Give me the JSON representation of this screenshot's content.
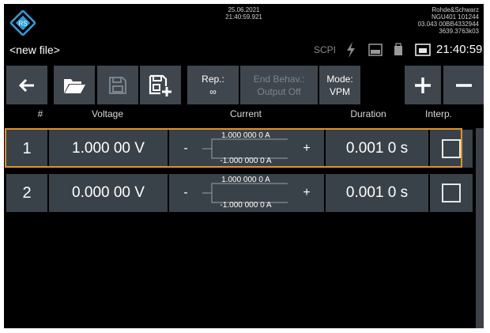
{
  "status": {
    "date": "25.06.2021",
    "time_precise": "21:40:59.921",
    "brand": "Rohde&Schwarz",
    "model": "NGU401 101244",
    "firmware": "03.043 00BB4332944",
    "version": "3639.3763k03",
    "scpi_label": "SCPI",
    "clock": "21:40:59"
  },
  "file": {
    "name": "<new file>"
  },
  "toolbar": {
    "repetition": {
      "label": "Rep.:",
      "value": "∞"
    },
    "end_behavior": {
      "label": "End Behav.:",
      "value": "Output Off"
    },
    "mode": {
      "label": "Mode:",
      "value": "VPM"
    }
  },
  "table": {
    "headers": {
      "index": "#",
      "voltage": "Voltage",
      "current": "Current",
      "duration": "Duration",
      "interp": "Interp."
    },
    "rows": [
      {
        "index": "1",
        "voltage": "1.000 00 V",
        "current_upper": "1.000 000 0 A",
        "current_lower": "-1.000 000 0 A",
        "minus": "-",
        "plus": "+",
        "duration": "0.001 0 s",
        "interp": false
      },
      {
        "index": "2",
        "voltage": "0.000 00 V",
        "current_upper": "1.000 000 0 A",
        "current_lower": "-1.000 000 0 A",
        "minus": "-",
        "plus": "+",
        "duration": "0.001 0 s",
        "interp": false
      }
    ]
  },
  "colors": {
    "accent": "#e1912a",
    "panel": "#3a4249",
    "toolbar": "#3f464e",
    "logo": "#2f9bd7"
  }
}
